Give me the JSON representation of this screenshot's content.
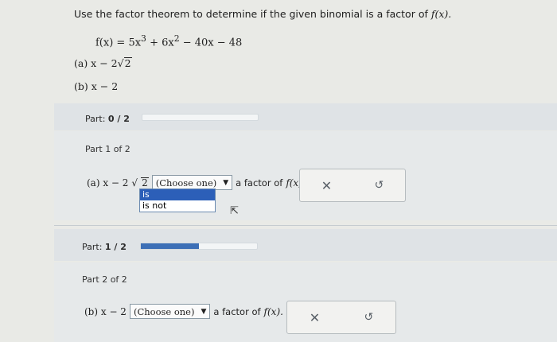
{
  "problem": {
    "instruction_prefix": "Use the factor theorem to determine if the given binomial is a factor of",
    "instruction_fx": "f(x).",
    "function_lhs": "f(x) = 5x",
    "exp1": "3",
    "term2": " + 6x",
    "exp2": "2",
    "rest": " − 40x − 48",
    "a_label": "(a) x − 2",
    "a_radical": "2",
    "b_label": "(b) x − 2"
  },
  "part_summary_1": {
    "label": "Part:",
    "value": "0 / 2",
    "progress": 0
  },
  "part1": {
    "title": "Part 1 of 2",
    "question_prefix": "(a) x − 2",
    "radical": "2",
    "select_value": "(Choose one)",
    "select_caret": "▼",
    "suffix": "a factor of",
    "suffix_fx": "f(x).",
    "dropdown_options": [
      "is",
      "is not"
    ],
    "dropdown_selected_index": 0
  },
  "part_summary_2": {
    "label": "Part:",
    "value": "1 / 2",
    "progress": 0.5
  },
  "part2": {
    "title": "Part 2 of 2",
    "question_prefix": "(b) x − 2",
    "select_value": "(Choose one)",
    "select_caret": "▼",
    "suffix": "a factor of",
    "suffix_fx": "f(x)."
  },
  "actions": {
    "clear_glyph": "✕",
    "reset_glyph": "↺"
  },
  "icons": {
    "cursor": "cursor-arrow-icon",
    "clear": "close-icon",
    "reset": "undo-icon"
  },
  "colors": {
    "progress": "#3d6fb6",
    "selected_option": "#2c5fb8"
  }
}
